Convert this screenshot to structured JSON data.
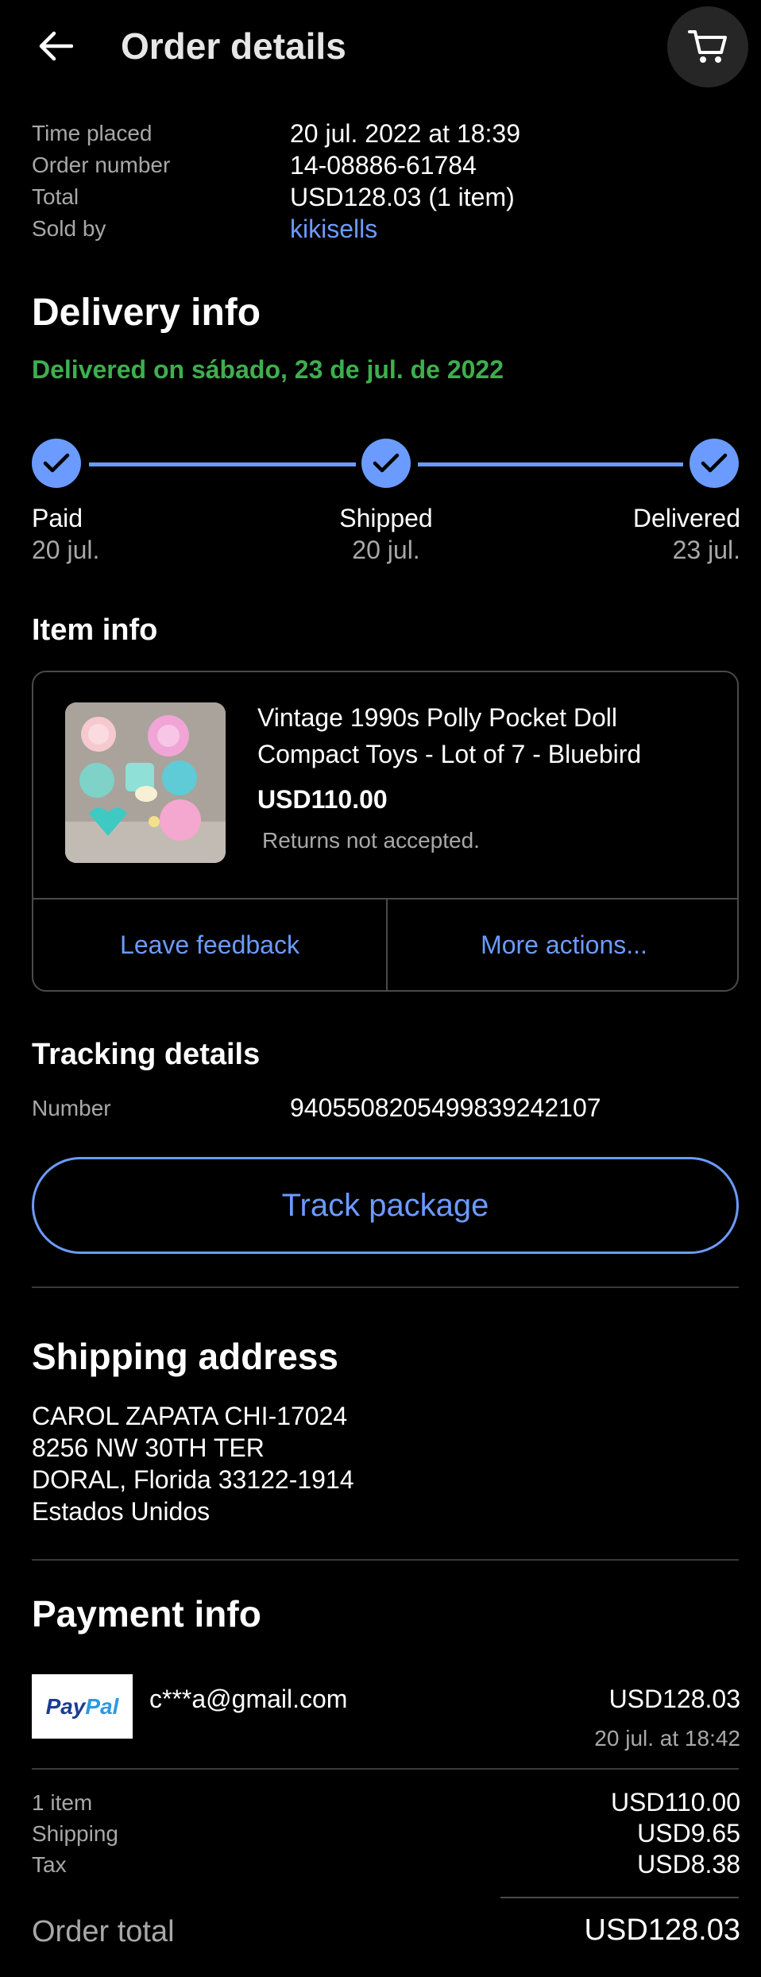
{
  "header": {
    "title": "Order details",
    "back_icon": "arrow-left-icon",
    "cart_icon": "cart-icon"
  },
  "summary": {
    "time_placed_label": "Time placed",
    "time_placed": "20 jul. 2022 at 18:39",
    "order_number_label": "Order number",
    "order_number": "14-08886-61784",
    "total_label": "Total",
    "total": "USD128.03 (1 item)",
    "sold_by_label": "Sold by",
    "sold_by": "kikisells"
  },
  "delivery": {
    "title": "Delivery info",
    "status": "Delivered on sábado, 23 de jul. de 2022",
    "steps": [
      {
        "name": "Paid",
        "date": "20 jul."
      },
      {
        "name": "Shipped",
        "date": "20 jul."
      },
      {
        "name": "Delivered",
        "date": "23 jul."
      }
    ]
  },
  "item": {
    "section_title": "Item info",
    "title": "Vintage 1990s Polly Pocket Doll Compact Toys  - Lot of 7 - Bluebird",
    "price": "USD110.00",
    "returns": "Returns not accepted.",
    "leave_feedback": "Leave feedback",
    "more_actions": "More actions..."
  },
  "tracking": {
    "title": "Tracking details",
    "number_label": "Number",
    "number": "9405508205499839242107",
    "button": "Track package"
  },
  "shipping": {
    "title": "Shipping address",
    "lines": [
      "CAROL ZAPATA CHI-17024",
      "8256 NW 30TH TER",
      "DORAL, Florida 33122-1914",
      "Estados Unidos"
    ]
  },
  "payment": {
    "title": "Payment info",
    "logo_pay": "Pay",
    "logo_pal": "Pal",
    "email": "c***a@gmail.com",
    "amount": "USD128.03",
    "date": "20 jul. at 18:42",
    "breakdown": [
      {
        "label": "1 item",
        "value": "USD110.00"
      },
      {
        "label": "Shipping",
        "value": "USD9.65"
      },
      {
        "label": "Tax",
        "value": "USD8.38"
      }
    ],
    "order_total_label": "Order total",
    "order_total": "USD128.03"
  },
  "colors": {
    "accent": "#6b9bff",
    "success": "#3fae4f",
    "background": "#000000"
  }
}
